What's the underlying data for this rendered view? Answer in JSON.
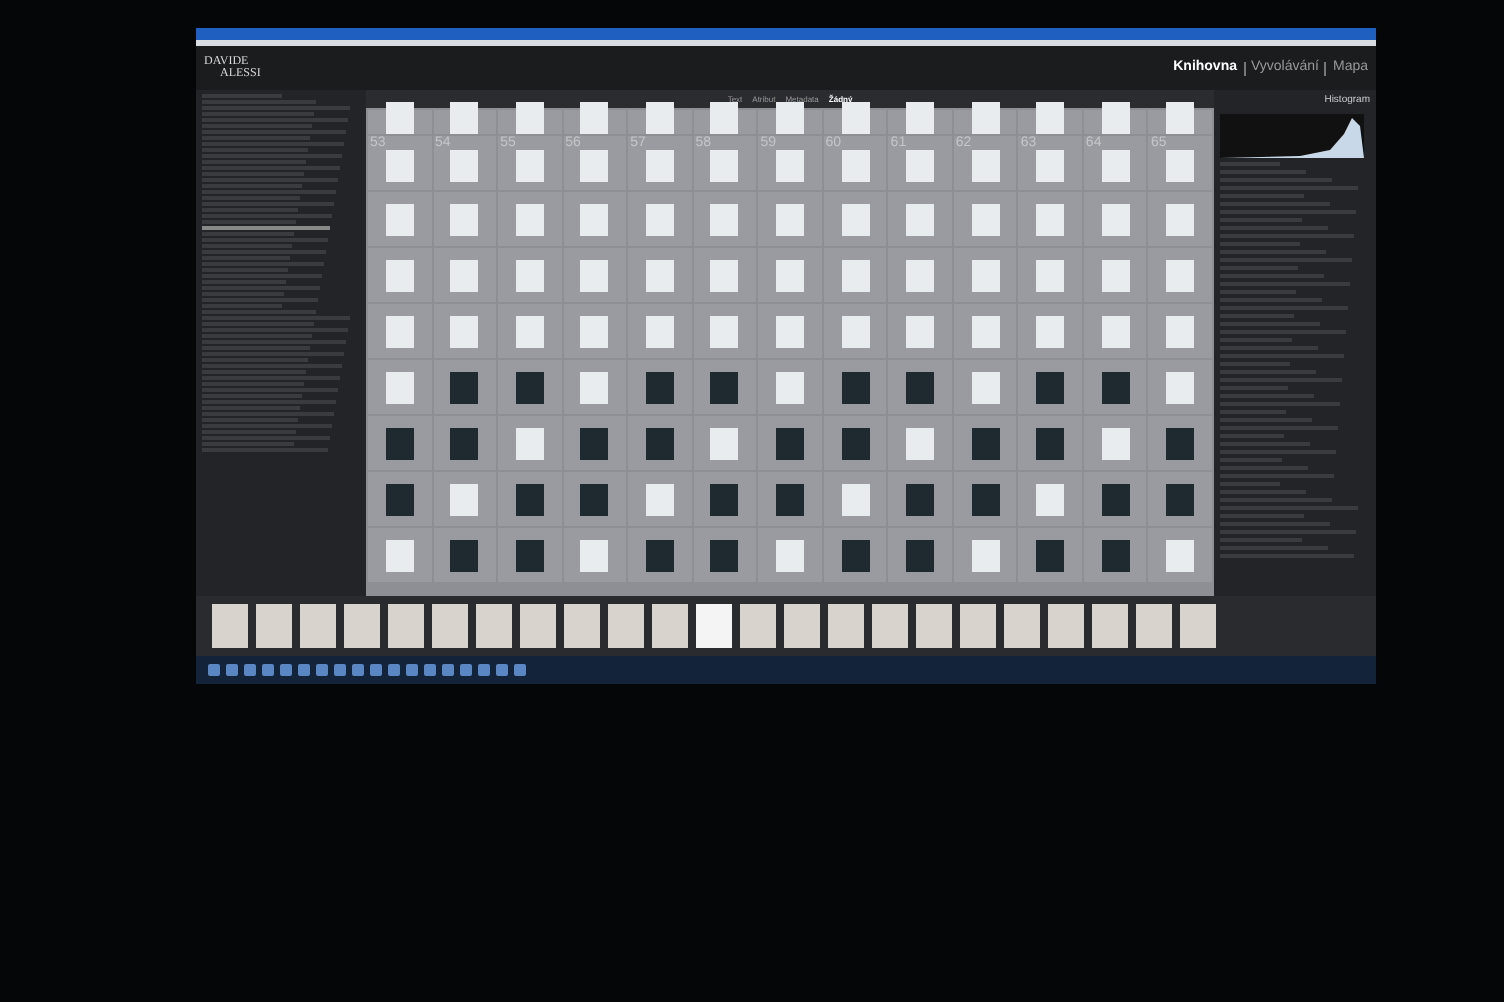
{
  "logo": {
    "line1": "DAVIDE",
    "line2": "ALESSI"
  },
  "modules": [
    {
      "label": "Knihovna",
      "selected": true
    },
    {
      "label": "Vyvolávání",
      "selected": false
    },
    {
      "label": "Mapa",
      "selected": false
    }
  ],
  "filter_bar": [
    {
      "label": "Text",
      "selected": false
    },
    {
      "label": "Atribut",
      "selected": false
    },
    {
      "label": "Metadata",
      "selected": false
    },
    {
      "label": "Žádný",
      "selected": true
    }
  ],
  "grid": {
    "numbered_row": [
      "53",
      "54",
      "55",
      "56",
      "57",
      "58",
      "59",
      "60",
      "61",
      "62",
      "63",
      "64",
      "65"
    ]
  },
  "right_panel": {
    "title": "Histogram"
  }
}
